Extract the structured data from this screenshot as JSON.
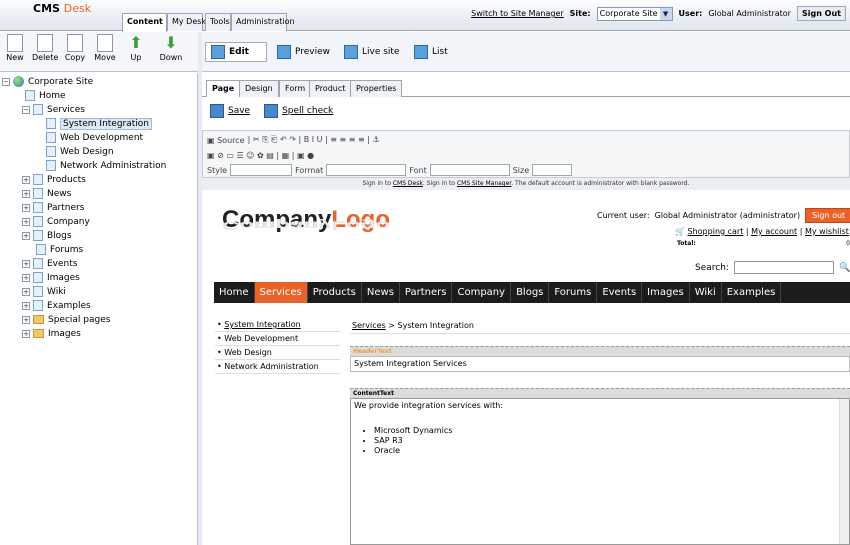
{
  "app": {
    "brand_a": "CMS",
    "brand_b": "Desk"
  },
  "top_tabs": [
    "Content",
    "My Desk",
    "Tools",
    "Administration"
  ],
  "topright": {
    "switch": "Switch to Site Manager",
    "site_label": "Site:",
    "site_value": "Corporate Site",
    "user_label": "User:",
    "user_value": "Global Administrator",
    "signout": "Sign Out"
  },
  "toolbar": [
    "New",
    "Delete",
    "Copy",
    "Move",
    "Up",
    "Down"
  ],
  "tree": {
    "root": "Corporate Site",
    "items": [
      "Home",
      "Services",
      "System Integration",
      "Web Development",
      "Web Design",
      "Network Administration",
      "Products",
      "News",
      "Partners",
      "Company",
      "Blogs",
      "Forums",
      "Events",
      "Images",
      "Wiki",
      "Examples",
      "Special pages",
      "Images"
    ]
  },
  "modes": [
    "Edit",
    "Preview",
    "Live site",
    "List"
  ],
  "page_tabs": [
    "Page",
    "Design",
    "Form",
    "Product",
    "Properties"
  ],
  "actions": {
    "save": "Save",
    "spell": "Spell check"
  },
  "editor": {
    "source": "Source",
    "style": "Style",
    "format": "Format",
    "font": "Font",
    "size": "Size"
  },
  "signin": {
    "t1": "Sign in to",
    "l1": "CMS Desk",
    "t2": ". Sign in to",
    "l2": "CMS Site Manager",
    "t3": ". The default account is administrator with blank password."
  },
  "site": {
    "logo_a": "Company",
    "logo_b": "Logo",
    "current_user_label": "Current user:",
    "current_user": "Global Administrator (administrator)",
    "signout": "Sign out",
    "cart": "Shopping cart",
    "account": "My account",
    "wishlist": "My wishlist",
    "total_label": "Total:",
    "total": "0",
    "search": "Search:"
  },
  "nav": [
    "Home",
    "Services",
    "Products",
    "News",
    "Partners",
    "Company",
    "Blogs",
    "Forums",
    "Events",
    "Images",
    "Wiki",
    "Examples"
  ],
  "leftmenu": [
    "System Integration",
    "Web Development",
    "Web Design",
    "Network Administration"
  ],
  "crumb": {
    "link": "Services",
    "sep": " > ",
    "current": "System Integration"
  },
  "header_zone": {
    "label": "HeaderText",
    "value": "System Integration Services"
  },
  "content_zone": {
    "label": "ContentText",
    "intro": "We provide integration services with:",
    "items": [
      "Microsoft Dynamics",
      "SAP R3",
      "Oracle"
    ]
  }
}
